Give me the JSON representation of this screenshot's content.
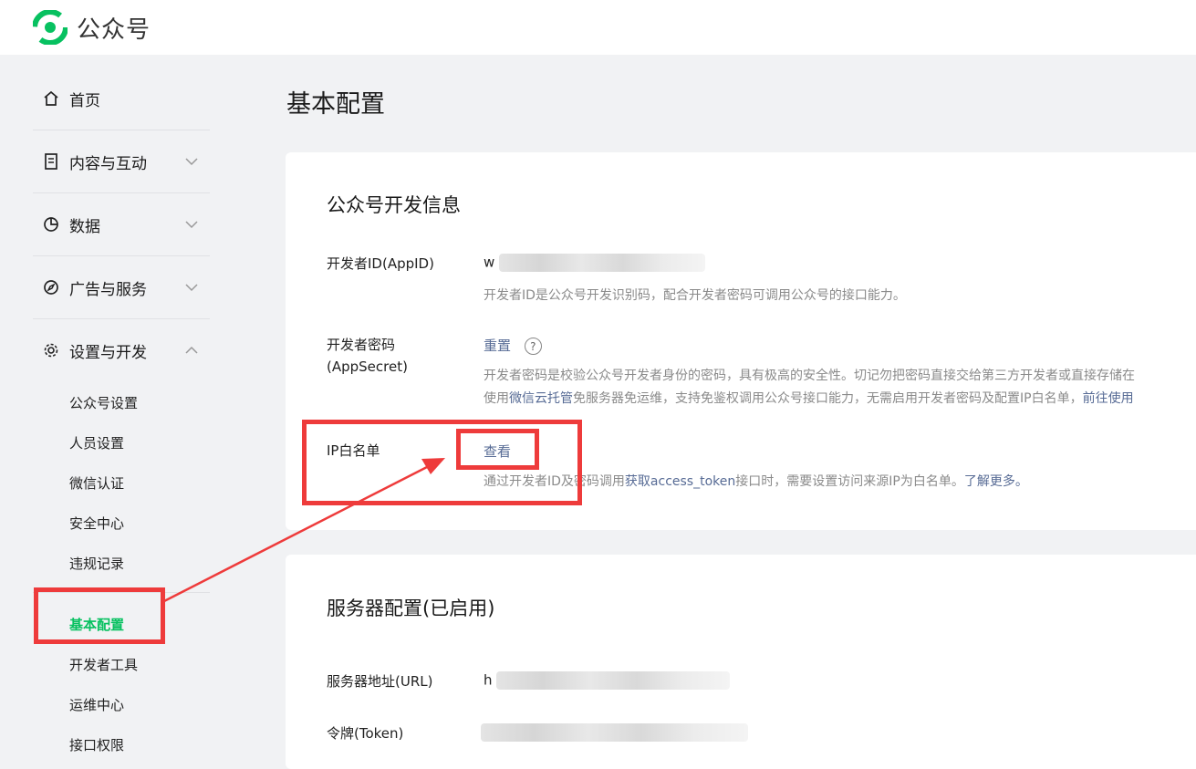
{
  "header": {
    "brand": "公众号",
    "logo_icon": "wechat-official-logo-icon",
    "brand_color": "#07c160"
  },
  "sidebar": {
    "home": {
      "label": "首页",
      "icon": "home-icon"
    },
    "content": {
      "label": "内容与互动",
      "icon": "document-icon"
    },
    "data": {
      "label": "数据",
      "icon": "pie-chart-icon"
    },
    "ads": {
      "label": "广告与服务",
      "icon": "compass-icon"
    },
    "settings": {
      "label": "设置与开发",
      "icon": "gear-icon",
      "children": [
        "公众号设置",
        "人员设置",
        "微信认证",
        "安全中心",
        "违规记录"
      ]
    },
    "dev": {
      "children": [
        "基本配置",
        "开发者工具",
        "运维中心",
        "接口权限"
      ],
      "active": "基本配置"
    }
  },
  "main": {
    "title": "基本配置",
    "dev_info": {
      "title": "公众号开发信息",
      "appid": {
        "label": "开发者ID(AppID)",
        "value_prefix": "w",
        "desc": "开发者ID是公众号开发识别码，配合开发者密码可调用公众号的接口能力。"
      },
      "appsecret": {
        "label": "开发者密码(AppSecret)",
        "action": "重置",
        "help": "?",
        "desc1": "开发者密码是校验公众号开发者身份的密码，具有极高的安全性。切记勿把密码直接交给第三方开发者或直接存储在",
        "desc2_a": "使用",
        "desc2_link": "微信云托管",
        "desc2_b": "免服务器免运维，支持免鉴权调用公众号接口能力，无需启用开发者密码及配置IP白名单，",
        "desc2_link2": "前往使用"
      },
      "ip_whitelist": {
        "label": "IP白名单",
        "action": "查看",
        "desc_a": "通过开发者ID及密码调用",
        "desc_link": "获取access_token",
        "desc_b": "接口时，需要设置访问来源IP为白名单。",
        "desc_link2": "了解更多。"
      }
    },
    "server": {
      "title": "服务器配置(已启用)",
      "url": {
        "label": "服务器地址(URL)",
        "value_prefix": "h"
      },
      "token": {
        "label": "令牌(Token)"
      }
    }
  }
}
